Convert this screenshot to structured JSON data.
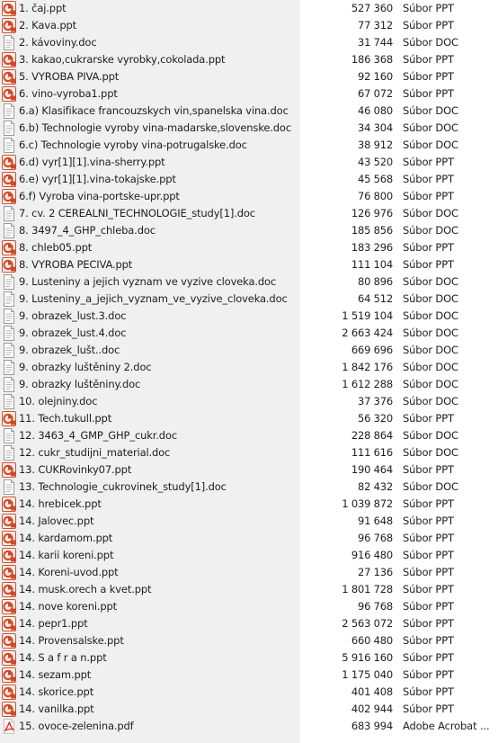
{
  "files": [
    {
      "name": "1. čaj.ppt",
      "size": "527 360",
      "type": "Súbor PPT",
      "icon": "ppt-file-icon"
    },
    {
      "name": "2. Kava.ppt",
      "size": "77 312",
      "type": "Súbor PPT",
      "icon": "ppt-file-icon"
    },
    {
      "name": "2. kávoviny.doc",
      "size": "31 744",
      "type": "Súbor DOC",
      "icon": "doc-file-icon"
    },
    {
      "name": "3. kakao,cukrarske vyrobky,cokolada.ppt",
      "size": "186 368",
      "type": "Súbor PPT",
      "icon": "ppt-file-icon"
    },
    {
      "name": "5. VYROBA PIVA.ppt",
      "size": "92 160",
      "type": "Súbor PPT",
      "icon": "ppt-file-icon"
    },
    {
      "name": "6. vino-vyroba1.ppt",
      "size": "67 072",
      "type": "Súbor PPT",
      "icon": "ppt-file-icon"
    },
    {
      "name": "6.a) Klasifikace francouzskych vin,spanelska vina.doc",
      "size": "46 080",
      "type": "Súbor DOC",
      "icon": "doc-file-icon"
    },
    {
      "name": "6.b) Technologie vyroby vina-madarske,slovenske.doc",
      "size": "34 304",
      "type": "Súbor DOC",
      "icon": "doc-file-icon"
    },
    {
      "name": "6.c) Technologie vyroby vina-potrugalske.doc",
      "size": "38 912",
      "type": "Súbor DOC",
      "icon": "doc-file-icon"
    },
    {
      "name": "6.d) vyr[1][1].vina-sherry.ppt",
      "size": "43 520",
      "type": "Súbor PPT",
      "icon": "ppt-file-icon"
    },
    {
      "name": "6.e) vyr[1][1].vina-tokajske.ppt",
      "size": "45 568",
      "type": "Súbor PPT",
      "icon": "ppt-file-icon"
    },
    {
      "name": "6.f) Vyroba vina-portske-upr.ppt",
      "size": "76 800",
      "type": "Súbor PPT",
      "icon": "ppt-file-icon"
    },
    {
      "name": "7. cv. 2 CEREALNI_TECHNOLOGIE_study[1].doc",
      "size": "126 976",
      "type": "Súbor DOC",
      "icon": "doc-file-icon"
    },
    {
      "name": "8. 3497_4_GHP_chleba.doc",
      "size": "185 856",
      "type": "Súbor DOC",
      "icon": "doc-file-icon"
    },
    {
      "name": "8. chleb05.ppt",
      "size": "183 296",
      "type": "Súbor PPT",
      "icon": "ppt-file-icon"
    },
    {
      "name": "8. VYROBA PECIVA.ppt",
      "size": "111 104",
      "type": "Súbor PPT",
      "icon": "ppt-file-icon"
    },
    {
      "name": "9. Lusteniny a jejich vyznam ve vyzive cloveka.doc",
      "size": "80 896",
      "type": "Súbor DOC",
      "icon": "doc-file-icon"
    },
    {
      "name": "9. Lusteniny_a_jejich_vyznam_ve_vyzive_cloveka.doc",
      "size": "64 512",
      "type": "Súbor DOC",
      "icon": "doc-file-icon"
    },
    {
      "name": "9. obrazek_lust.3.doc",
      "size": "1 519 104",
      "type": "Súbor DOC",
      "icon": "doc-file-icon"
    },
    {
      "name": "9. obrazek_lust.4.doc",
      "size": "2 663 424",
      "type": "Súbor DOC",
      "icon": "doc-file-icon"
    },
    {
      "name": "9. obrazek_lušt..doc",
      "size": "669 696",
      "type": "Súbor DOC",
      "icon": "doc-file-icon"
    },
    {
      "name": "9. obrazky luštěniny 2.doc",
      "size": "1 842 176",
      "type": "Súbor DOC",
      "icon": "doc-file-icon"
    },
    {
      "name": "9. obrazky luštěniny.doc",
      "size": "1 612 288",
      "type": "Súbor DOC",
      "icon": "doc-file-icon"
    },
    {
      "name": "10. olejniny.doc",
      "size": "37 376",
      "type": "Súbor DOC",
      "icon": "doc-file-icon"
    },
    {
      "name": "11. Tech.tukull.ppt",
      "size": "56 320",
      "type": "Súbor PPT",
      "icon": "ppt-file-icon"
    },
    {
      "name": "12. 3463_4_GMP_GHP_cukr.doc",
      "size": "228 864",
      "type": "Súbor DOC",
      "icon": "doc-file-icon"
    },
    {
      "name": "12. cukr_studijni_material.doc",
      "size": "111 616",
      "type": "Súbor DOC",
      "icon": "doc-file-icon"
    },
    {
      "name": "13. CUKRovinky07.ppt",
      "size": "190 464",
      "type": "Súbor PPT",
      "icon": "ppt-file-icon"
    },
    {
      "name": "13. Technologie_cukrovinek_study[1].doc",
      "size": "82 432",
      "type": "Súbor DOC",
      "icon": "doc-file-icon"
    },
    {
      "name": "14. hrebicek.ppt",
      "size": "1 039 872",
      "type": "Súbor PPT",
      "icon": "ppt-file-icon"
    },
    {
      "name": "14. Jalovec.ppt",
      "size": "91 648",
      "type": "Súbor PPT",
      "icon": "ppt-file-icon"
    },
    {
      "name": "14. kardamom.ppt",
      "size": "96 768",
      "type": "Súbor PPT",
      "icon": "ppt-file-icon"
    },
    {
      "name": "14. karii koreni.ppt",
      "size": "916 480",
      "type": "Súbor PPT",
      "icon": "ppt-file-icon"
    },
    {
      "name": "14. Koreni-uvod.ppt",
      "size": "27 136",
      "type": "Súbor PPT",
      "icon": "ppt-file-icon"
    },
    {
      "name": "14. musk.orech a kvet.ppt",
      "size": "1 801 728",
      "type": "Súbor PPT",
      "icon": "ppt-file-icon"
    },
    {
      "name": "14. nove koreni.ppt",
      "size": "96 768",
      "type": "Súbor PPT",
      "icon": "ppt-file-icon"
    },
    {
      "name": "14. pepr1.ppt",
      "size": "2 563 072",
      "type": "Súbor PPT",
      "icon": "ppt-file-icon"
    },
    {
      "name": "14. Provensalske.ppt",
      "size": "660 480",
      "type": "Súbor PPT",
      "icon": "ppt-file-icon"
    },
    {
      "name": "14. S a f r a n.ppt",
      "size": "5 916 160",
      "type": "Súbor PPT",
      "icon": "ppt-file-icon"
    },
    {
      "name": "14. sezam.ppt",
      "size": "1 175 040",
      "type": "Súbor PPT",
      "icon": "ppt-file-icon"
    },
    {
      "name": "14. skorice.ppt",
      "size": "401 408",
      "type": "Súbor PPT",
      "icon": "ppt-file-icon"
    },
    {
      "name": "14. vanilka.ppt",
      "size": "402 944",
      "type": "Súbor PPT",
      "icon": "ppt-file-icon"
    },
    {
      "name": "15. ovoce-zelenina.pdf",
      "size": "683 994",
      "type": "Adobe Acrobat ...",
      "icon": "pdf-file-icon"
    }
  ],
  "colors": {
    "left_pane_bg": "#f0f0f0",
    "right_pane_bg": "#ffffff",
    "ppt_icon_accent": "#d24726",
    "pdf_icon_accent": "#e0201b",
    "doc_icon_border": "#9a9a9a"
  }
}
